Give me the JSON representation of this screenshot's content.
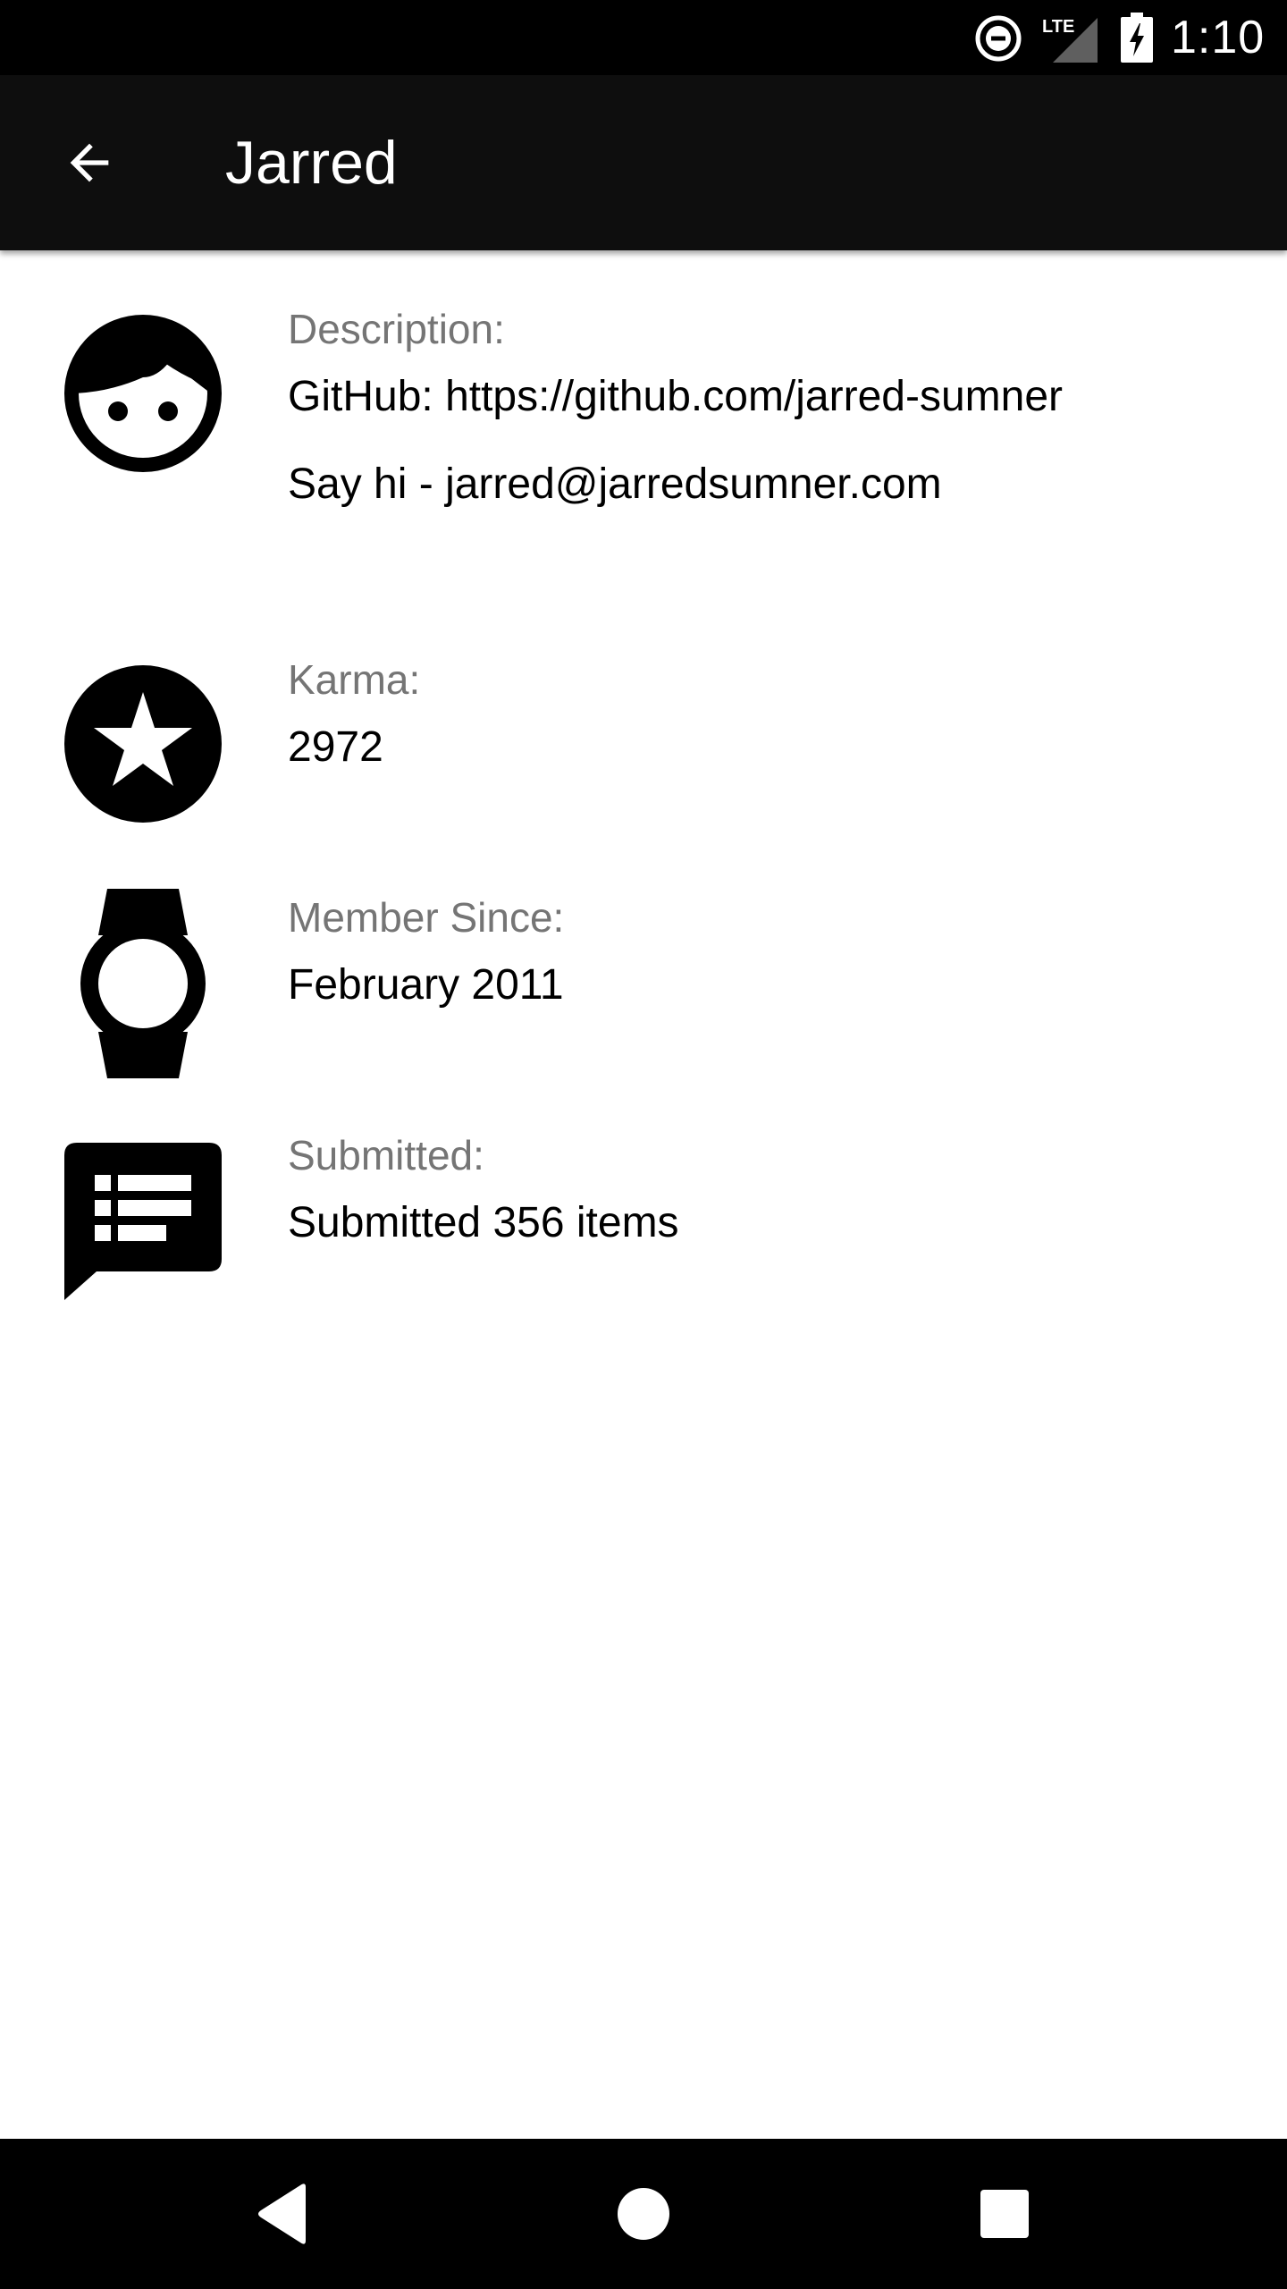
{
  "status_bar": {
    "network_label": "LTE",
    "time": "1:10",
    "icons": [
      "do-not-disturb-icon",
      "cell-signal-icon",
      "battery-charging-icon"
    ]
  },
  "app_bar": {
    "title": "Jarred",
    "back_icon": "arrow-back-icon"
  },
  "profile": {
    "description": {
      "icon": "face-icon",
      "label": "Description:",
      "lines": [
        "GitHub: https://github.com/jarred-sumner",
        "Say hi - jarred@jarredsumner.com"
      ]
    },
    "karma": {
      "icon": "stars-icon",
      "label": "Karma:",
      "value": "2972"
    },
    "member_since": {
      "icon": "watch-icon",
      "label": "Member Since:",
      "value": "February 2011"
    },
    "submitted": {
      "icon": "feedback-list-icon",
      "label": "Submitted:",
      "value": "Submitted 356 items"
    }
  },
  "nav_bar": {
    "buttons": [
      "nav-back-icon",
      "nav-home-icon",
      "nav-recents-icon"
    ]
  },
  "colors": {
    "status_bar": "#000000",
    "app_bar": "#0e0e0e",
    "background": "#ffffff",
    "label": "#757575",
    "value": "#000000"
  }
}
